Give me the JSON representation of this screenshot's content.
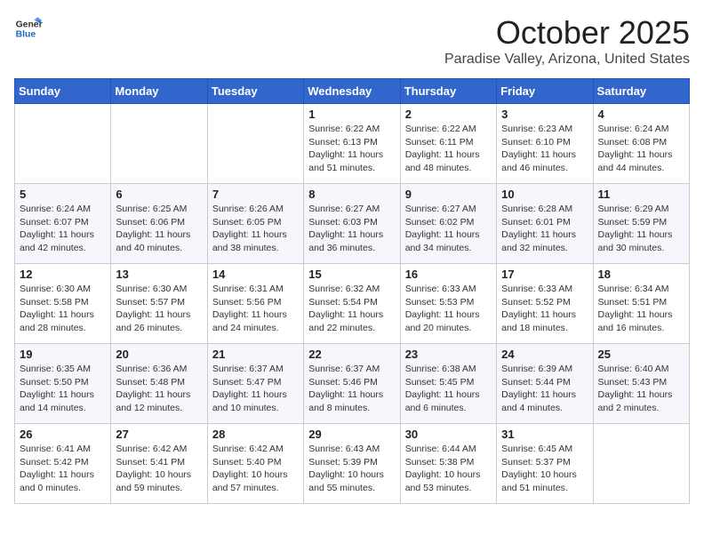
{
  "logo": {
    "line1": "General",
    "line2": "Blue"
  },
  "header": {
    "month": "October 2025",
    "location": "Paradise Valley, Arizona, United States"
  },
  "weekdays": [
    "Sunday",
    "Monday",
    "Tuesday",
    "Wednesday",
    "Thursday",
    "Friday",
    "Saturday"
  ],
  "weeks": [
    [
      {
        "day": "",
        "info": ""
      },
      {
        "day": "",
        "info": ""
      },
      {
        "day": "",
        "info": ""
      },
      {
        "day": "1",
        "info": "Sunrise: 6:22 AM\nSunset: 6:13 PM\nDaylight: 11 hours\nand 51 minutes."
      },
      {
        "day": "2",
        "info": "Sunrise: 6:22 AM\nSunset: 6:11 PM\nDaylight: 11 hours\nand 48 minutes."
      },
      {
        "day": "3",
        "info": "Sunrise: 6:23 AM\nSunset: 6:10 PM\nDaylight: 11 hours\nand 46 minutes."
      },
      {
        "day": "4",
        "info": "Sunrise: 6:24 AM\nSunset: 6:08 PM\nDaylight: 11 hours\nand 44 minutes."
      }
    ],
    [
      {
        "day": "5",
        "info": "Sunrise: 6:24 AM\nSunset: 6:07 PM\nDaylight: 11 hours\nand 42 minutes."
      },
      {
        "day": "6",
        "info": "Sunrise: 6:25 AM\nSunset: 6:06 PM\nDaylight: 11 hours\nand 40 minutes."
      },
      {
        "day": "7",
        "info": "Sunrise: 6:26 AM\nSunset: 6:05 PM\nDaylight: 11 hours\nand 38 minutes."
      },
      {
        "day": "8",
        "info": "Sunrise: 6:27 AM\nSunset: 6:03 PM\nDaylight: 11 hours\nand 36 minutes."
      },
      {
        "day": "9",
        "info": "Sunrise: 6:27 AM\nSunset: 6:02 PM\nDaylight: 11 hours\nand 34 minutes."
      },
      {
        "day": "10",
        "info": "Sunrise: 6:28 AM\nSunset: 6:01 PM\nDaylight: 11 hours\nand 32 minutes."
      },
      {
        "day": "11",
        "info": "Sunrise: 6:29 AM\nSunset: 5:59 PM\nDaylight: 11 hours\nand 30 minutes."
      }
    ],
    [
      {
        "day": "12",
        "info": "Sunrise: 6:30 AM\nSunset: 5:58 PM\nDaylight: 11 hours\nand 28 minutes."
      },
      {
        "day": "13",
        "info": "Sunrise: 6:30 AM\nSunset: 5:57 PM\nDaylight: 11 hours\nand 26 minutes."
      },
      {
        "day": "14",
        "info": "Sunrise: 6:31 AM\nSunset: 5:56 PM\nDaylight: 11 hours\nand 24 minutes."
      },
      {
        "day": "15",
        "info": "Sunrise: 6:32 AM\nSunset: 5:54 PM\nDaylight: 11 hours\nand 22 minutes."
      },
      {
        "day": "16",
        "info": "Sunrise: 6:33 AM\nSunset: 5:53 PM\nDaylight: 11 hours\nand 20 minutes."
      },
      {
        "day": "17",
        "info": "Sunrise: 6:33 AM\nSunset: 5:52 PM\nDaylight: 11 hours\nand 18 minutes."
      },
      {
        "day": "18",
        "info": "Sunrise: 6:34 AM\nSunset: 5:51 PM\nDaylight: 11 hours\nand 16 minutes."
      }
    ],
    [
      {
        "day": "19",
        "info": "Sunrise: 6:35 AM\nSunset: 5:50 PM\nDaylight: 11 hours\nand 14 minutes."
      },
      {
        "day": "20",
        "info": "Sunrise: 6:36 AM\nSunset: 5:48 PM\nDaylight: 11 hours\nand 12 minutes."
      },
      {
        "day": "21",
        "info": "Sunrise: 6:37 AM\nSunset: 5:47 PM\nDaylight: 11 hours\nand 10 minutes."
      },
      {
        "day": "22",
        "info": "Sunrise: 6:37 AM\nSunset: 5:46 PM\nDaylight: 11 hours\nand 8 minutes."
      },
      {
        "day": "23",
        "info": "Sunrise: 6:38 AM\nSunset: 5:45 PM\nDaylight: 11 hours\nand 6 minutes."
      },
      {
        "day": "24",
        "info": "Sunrise: 6:39 AM\nSunset: 5:44 PM\nDaylight: 11 hours\nand 4 minutes."
      },
      {
        "day": "25",
        "info": "Sunrise: 6:40 AM\nSunset: 5:43 PM\nDaylight: 11 hours\nand 2 minutes."
      }
    ],
    [
      {
        "day": "26",
        "info": "Sunrise: 6:41 AM\nSunset: 5:42 PM\nDaylight: 11 hours\nand 0 minutes."
      },
      {
        "day": "27",
        "info": "Sunrise: 6:42 AM\nSunset: 5:41 PM\nDaylight: 10 hours\nand 59 minutes."
      },
      {
        "day": "28",
        "info": "Sunrise: 6:42 AM\nSunset: 5:40 PM\nDaylight: 10 hours\nand 57 minutes."
      },
      {
        "day": "29",
        "info": "Sunrise: 6:43 AM\nSunset: 5:39 PM\nDaylight: 10 hours\nand 55 minutes."
      },
      {
        "day": "30",
        "info": "Sunrise: 6:44 AM\nSunset: 5:38 PM\nDaylight: 10 hours\nand 53 minutes."
      },
      {
        "day": "31",
        "info": "Sunrise: 6:45 AM\nSunset: 5:37 PM\nDaylight: 10 hours\nand 51 minutes."
      },
      {
        "day": "",
        "info": ""
      }
    ]
  ]
}
